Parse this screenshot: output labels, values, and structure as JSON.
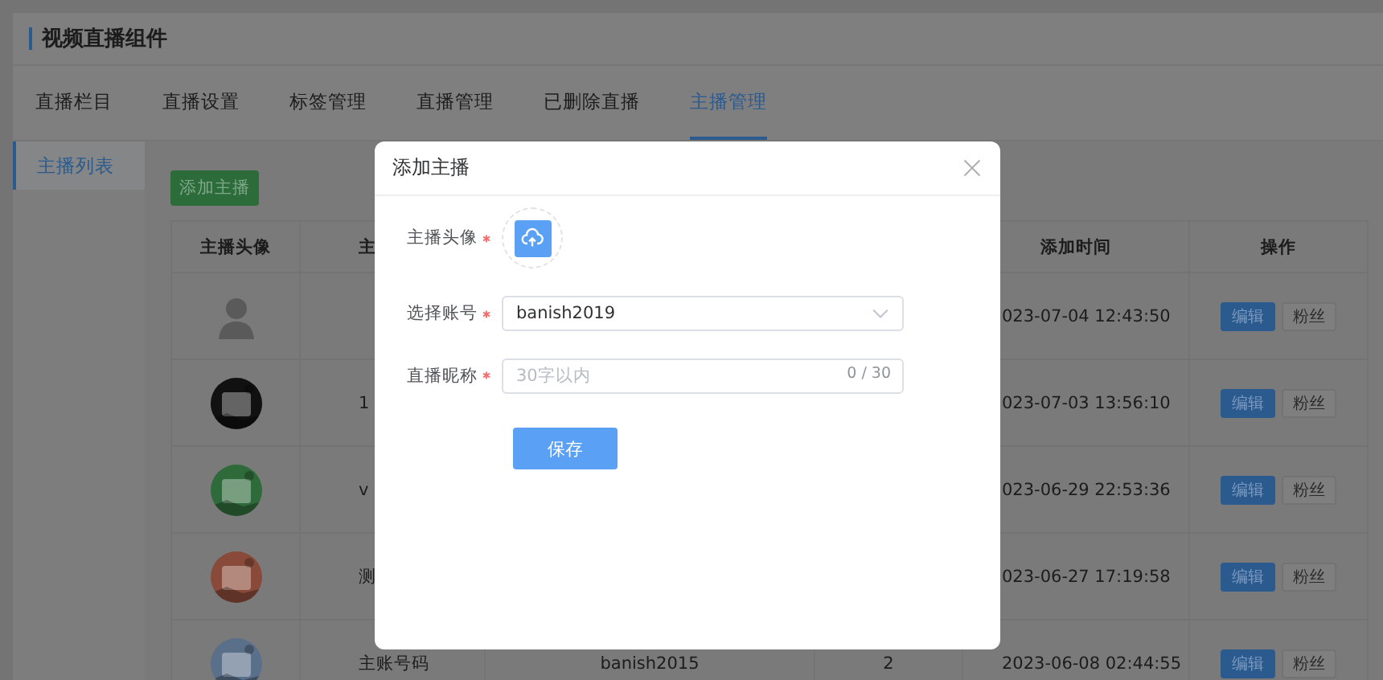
{
  "header": {
    "title": "视频直播组件"
  },
  "tabs": [
    {
      "label": "直播栏目",
      "selected": false
    },
    {
      "label": "直播设置",
      "selected": false
    },
    {
      "label": "标签管理",
      "selected": false
    },
    {
      "label": "直播管理",
      "selected": false
    },
    {
      "label": "已删除直播",
      "selected": false
    },
    {
      "label": "主播管理",
      "selected": true
    }
  ],
  "sidebar": {
    "items": [
      {
        "label": "主播列表",
        "selected": true
      }
    ]
  },
  "add_button": "添加主播",
  "table": {
    "columns": [
      "主播头像",
      "主",
      "添加时间",
      "操作"
    ],
    "rows": [
      {
        "avatar": {
          "kind": "silhouette"
        },
        "time": "023-07-04 12:43:50",
        "actions": [
          "编辑",
          "粉丝"
        ]
      },
      {
        "avatar": {
          "kind": "picture"
        },
        "name": "1",
        "time": "023-07-03 13:56:10",
        "actions": [
          "编辑",
          "粉丝"
        ]
      },
      {
        "avatar": {
          "kind": "picture"
        },
        "name": "v",
        "time": "023-06-29 22:53:36",
        "actions": [
          "编辑",
          "粉丝"
        ]
      },
      {
        "avatar": {
          "kind": "picture"
        },
        "name": "测",
        "time": "023-06-27 17:19:58",
        "actions": [
          "编辑",
          "粉丝"
        ]
      },
      {
        "avatar": {
          "kind": "picture"
        },
        "name": "主账号码",
        "account": "banish2015",
        "count": "2",
        "time": "2023-06-08 02:44:55",
        "actions": [
          "编辑",
          "粉丝"
        ]
      }
    ]
  },
  "dialog": {
    "title": "添加主播",
    "fields": [
      {
        "kind": "upload",
        "label": "主播头像",
        "required": true
      },
      {
        "kind": "select",
        "label": "选择账号",
        "required": true,
        "value": "banish2019"
      },
      {
        "kind": "text",
        "label": "直播昵称",
        "required": true,
        "placeholder": "30字以内",
        "counter": "0 / 30"
      }
    ],
    "submit": "保存"
  }
}
